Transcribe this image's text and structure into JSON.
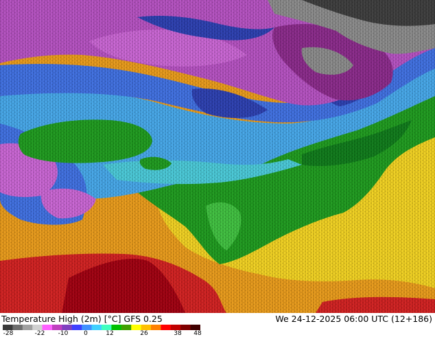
{
  "map": {
    "colors": {
      "deep_cold": "#3d3d3d",
      "cold_gray": "#8a8a8a",
      "purple_dark": "#8a2a8a",
      "purple": "#b450c0",
      "magenta": "#c864d2",
      "blue_dark": "#2c3fb0",
      "blue": "#3f6fe0",
      "cyan": "#45a6e8",
      "aqua": "#49c8d6",
      "green_light": "#3fbf3f",
      "green": "#1e9a1e",
      "green_dark": "#0f7a1a",
      "yellow": "#f0d020",
      "orange": "#e89a1a",
      "red": "#d02020",
      "dark_red": "#a00010"
    }
  },
  "footer": {
    "title": "Temperature High (2m) [°C] GFS 0.25",
    "datetime": "We 24-12-2025 06:00 UTC (12+186)"
  },
  "legend": {
    "ticks": [
      "-28",
      "-22",
      "-10",
      "0",
      "12",
      "26",
      "38",
      "48"
    ],
    "colors": [
      "#3a3a3a",
      "#6e6e6e",
      "#a0a0a0",
      "#d0d0d0",
      "#ff60ff",
      "#c040c0",
      "#8040c0",
      "#4040ff",
      "#4090ff",
      "#40d0ff",
      "#40ffc0",
      "#00c000",
      "#40a000",
      "#ffff00",
      "#ffc000",
      "#ff8000",
      "#ff0000",
      "#c00000",
      "#800000",
      "#400000"
    ]
  }
}
